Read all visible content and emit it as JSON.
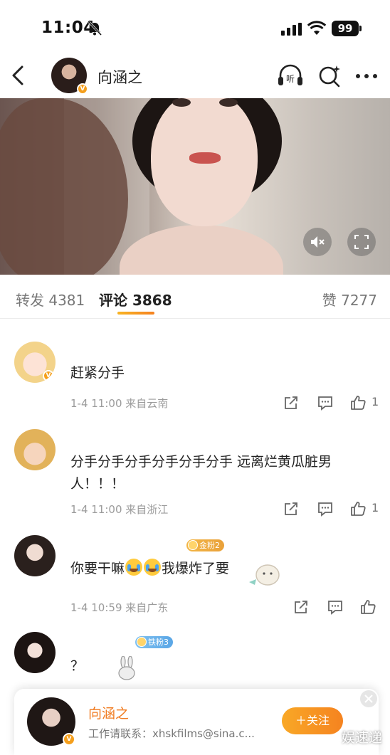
{
  "status_bar": {
    "time": "11:04",
    "battery": "99"
  },
  "header": {
    "name": "向涵之",
    "listen_label": "听"
  },
  "tabs": {
    "repost_label": "转发",
    "repost_count": "4381",
    "comments_label": "评论",
    "comments_count": "3868",
    "likes_label": "赞",
    "likes_count": "7277"
  },
  "comments": [
    {
      "text": "赶紧分手",
      "time": "1-4 11:00",
      "location": "来自云南",
      "likes": "1"
    },
    {
      "text_line1": "分手分手分手分手分手分手 远离烂黄瓜脏男",
      "text_line2": "人！！！",
      "time": "1-4 11:00",
      "location": "来自浙江",
      "likes": "1"
    },
    {
      "badge": "金粉2",
      "text_before": "你要干嘛",
      "text_after": "我爆炸了要",
      "time": "1-4 10:59",
      "location": "来自广东"
    },
    {
      "badge": "铁粉3",
      "text": "？"
    }
  ],
  "profile_card": {
    "name": "向涵之",
    "desc": "工作请联系：xhskfilms@sina.c...",
    "follow_label": "＋关注"
  },
  "watermark": "娱速递",
  "colors": {
    "accent": "#f58320",
    "name_orange": "#f07a1e",
    "vip": "#f59f1c"
  }
}
